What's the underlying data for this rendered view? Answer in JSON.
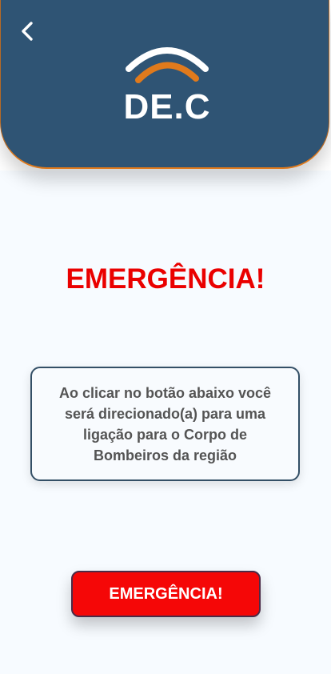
{
  "header": {
    "logo_text": "DE.C",
    "back_icon": "chevron-left-icon",
    "logo_icon": "signal-arcs-icon",
    "colors": {
      "background": "#2f5474",
      "accent": "#e07a1c"
    }
  },
  "main": {
    "title": "EMERGÊNCIA!",
    "info_text": "Ao clicar no botão abaixo você será direcionado(a) para uma ligação para o Corpo de Bombeiros da região",
    "button_label": "EMERGÊNCIA!",
    "colors": {
      "title": "#ea0000",
      "button": "#f50707"
    }
  }
}
